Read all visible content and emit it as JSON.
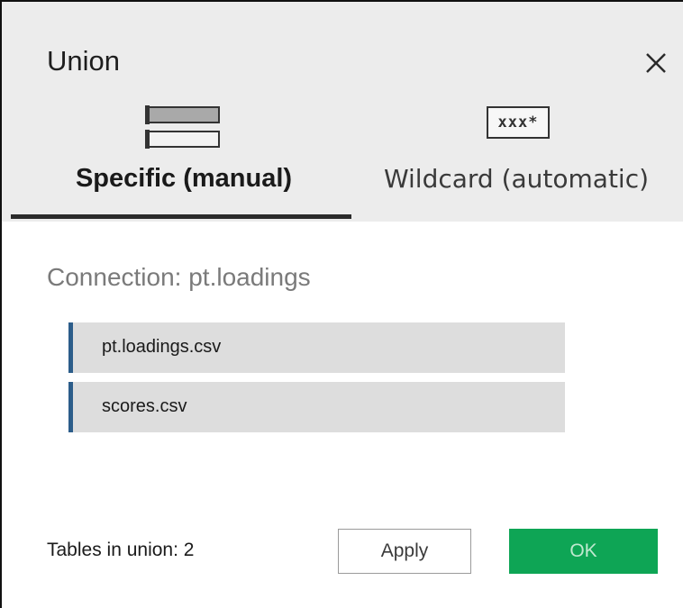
{
  "dialog": {
    "title": "Union",
    "close_icon": "close-icon"
  },
  "tabs": [
    {
      "label": "Specific (manual)",
      "icon": "stacked-tables-icon",
      "selected": true
    },
    {
      "label": "Wildcard (automatic)",
      "icon": "wildcard-icon",
      "icon_text": "xxx*",
      "selected": false
    }
  ],
  "connection": {
    "label": "Connection: pt.loadings"
  },
  "tables": [
    {
      "name": "pt.loadings.csv"
    },
    {
      "name": "scores.csv"
    }
  ],
  "footer": {
    "count_text": "Tables in union: 2",
    "apply_label": "Apply",
    "ok_label": "OK"
  },
  "colors": {
    "header_bg": "#ececec",
    "table_accent": "#2c5d8a",
    "ok_bg": "#0ea555",
    "ok_text": "#bfe9cf"
  }
}
